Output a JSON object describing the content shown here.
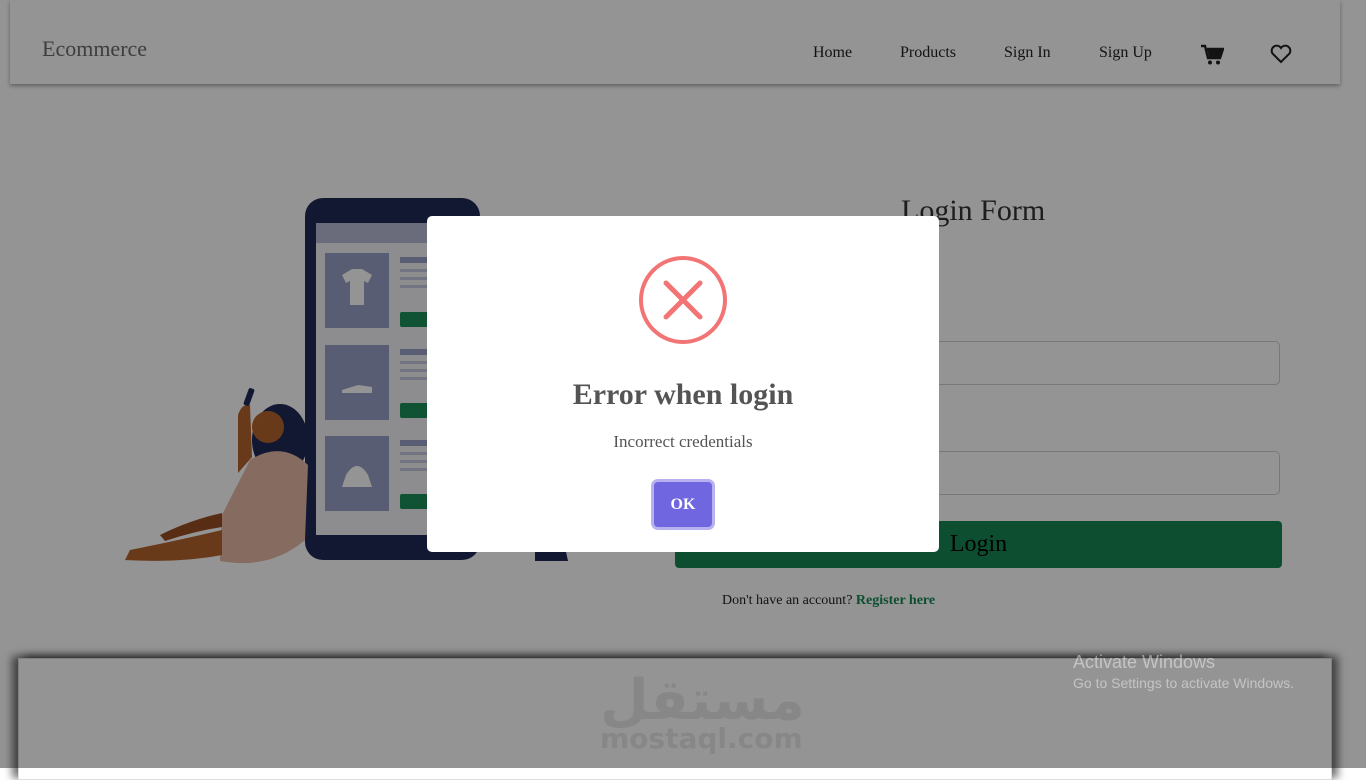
{
  "navbar": {
    "brand": "Ecommerce",
    "links": [
      "Home",
      "Products",
      "Sign In",
      "Sign Up"
    ],
    "icons": [
      "cart-icon",
      "heart-icon"
    ]
  },
  "login_form": {
    "title": "Login Form",
    "submit_label": "Login",
    "register_prompt": "Don't have an account?",
    "register_link": "Register here"
  },
  "modal": {
    "icon": "error-x-icon",
    "title": "Error when login",
    "message": "Incorrect credentials",
    "ok_label": "OK"
  },
  "watermark": {
    "arabic": "مستقل",
    "latin": "mostaql.com"
  },
  "windows_notice": {
    "line1": "Activate Windows",
    "line2": "Go to Settings to activate Windows."
  },
  "colors": {
    "accent_green": "#198754",
    "modal_button": "#7066e0",
    "error_red": "#f27474"
  }
}
